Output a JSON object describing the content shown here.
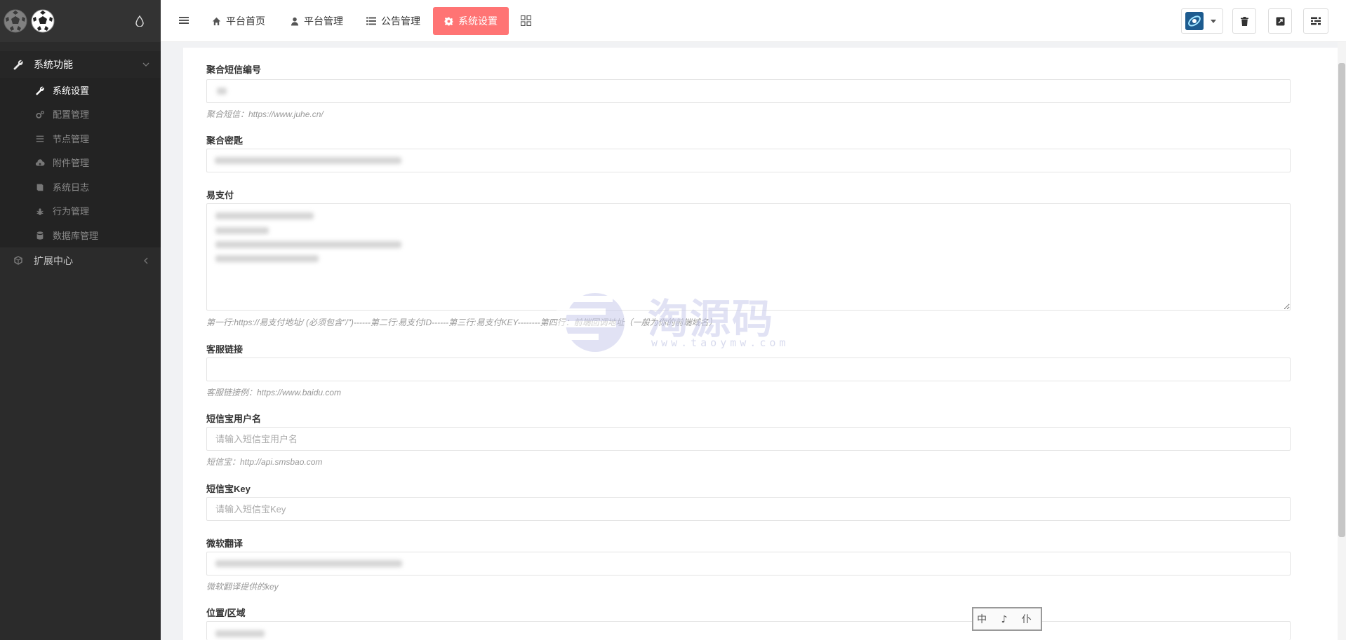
{
  "sidebar": {
    "groups": [
      {
        "label": "系统功能",
        "items": [
          {
            "label": "系统设置",
            "icon": "wrench-icon",
            "active": true
          },
          {
            "label": "配置管理",
            "icon": "cogs-icon"
          },
          {
            "label": "节点管理",
            "icon": "list-icon"
          },
          {
            "label": "附件管理",
            "icon": "cloud-upload-icon"
          },
          {
            "label": "系统日志",
            "icon": "book-icon"
          },
          {
            "label": "行为管理",
            "icon": "bug-icon"
          },
          {
            "label": "数据库管理",
            "icon": "database-icon"
          }
        ]
      },
      {
        "label": "扩展中心",
        "items": []
      }
    ]
  },
  "topnav": {
    "items": [
      {
        "label": "平台首页",
        "icon": "home-icon"
      },
      {
        "label": "平台管理",
        "icon": "user-icon"
      },
      {
        "label": "公告管理",
        "icon": "list-alt-icon"
      },
      {
        "label": "系统设置",
        "icon": "gear-icon",
        "active": true
      }
    ]
  },
  "form": {
    "fields": [
      {
        "label": "聚合短信编号",
        "help": "聚合短信：https://www.juhe.cn/",
        "value": "",
        "placeholder": ""
      },
      {
        "label": "聚合密匙",
        "help": "",
        "value": "",
        "placeholder": ""
      },
      {
        "label": "易支付",
        "help": "第一行:https://易支付地址/ (必须包含\"/\")------第二行:易支付ID------第三行:易支付KEY--------第四行：前端回调地址（一般为你的前端域名）",
        "value": ""
      },
      {
        "label": "客服链接",
        "help": "客服链接例：https://www.baidu.com",
        "value": "",
        "placeholder": ""
      },
      {
        "label": "短信宝用户名",
        "help": "短信宝：http://api.smsbao.com",
        "value": "",
        "placeholder": "请输入短信宝用户名"
      },
      {
        "label": "短信宝Key",
        "help": "",
        "value": "",
        "placeholder": "请输入短信宝Key"
      },
      {
        "label": "微软翻译",
        "help": "微软翻译提供的key",
        "value": "",
        "placeholder": ""
      },
      {
        "label": "位置/区域",
        "help": "",
        "value": "",
        "placeholder": ""
      }
    ]
  },
  "watermark": {
    "text": "淘源码",
    "url": "www.taoymw.com"
  },
  "stamp": {
    "text": "中 ♪ 仆"
  },
  "colors": {
    "sidebar_bg": "#2b2b2b",
    "accent": "#ff7474",
    "panel_bg": "#ffffff"
  }
}
